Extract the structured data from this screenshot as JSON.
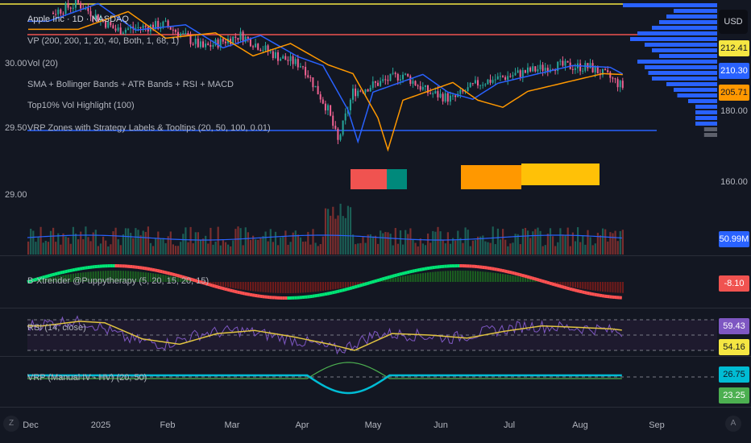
{
  "legends": {
    "symbol": "Apple Inc · 1D · NASDAQ",
    "vp": "VP (200, 200, 1, 20, 40, Both, 1, 68, 1)",
    "vol": "Vol (20)",
    "sma": "SMA + Bollinger Bands + ATR Bands + RSI + MACD",
    "top10": "Top10% Vol Highlight (100)",
    "vrpzones": "VRP Zones with Strategy Labels & Tooltips (20, 50, 100, 0.01)",
    "xtrender": "B-Xtrender @Puppytherapy (5, 20, 15, 20, 15)",
    "rsi": "RSI (14, close)",
    "vrp": "VRP (Manual IV - HV) (20, 50)"
  },
  "left_axis": [
    "30.00",
    "29.50",
    "29.00"
  ],
  "right_axis": {
    "currency": "USD",
    "price_labels": [
      {
        "text": "212.41",
        "bg": "#f5e642",
        "fg": "#131722"
      },
      {
        "text": "210.30",
        "bg": "#2962ff",
        "fg": "#ffffff"
      },
      {
        "text": "205.71",
        "bg": "#ff9800",
        "fg": "#131722"
      }
    ],
    "ticks": [
      "180.00",
      "160.00"
    ],
    "volume": {
      "text": "50.99M",
      "bg": "#2962ff"
    },
    "xtrender": {
      "text": "-8.10",
      "bg": "#f05350"
    },
    "rsi": [
      {
        "text": "59.43",
        "bg": "#7e57c2",
        "fg": "#ffffff"
      },
      {
        "text": "54.16",
        "bg": "#f5e642",
        "fg": "#131722"
      }
    ],
    "vrp": [
      {
        "text": "26.75",
        "bg": "#00bcd4",
        "fg": "#131722"
      },
      {
        "text": "23.25",
        "bg": "#4caf50",
        "fg": "#ffffff"
      }
    ]
  },
  "time_axis": [
    "Dec",
    "2025",
    "Feb",
    "Mar",
    "Apr",
    "May",
    "Jun",
    "Jul",
    "Aug",
    "Sep"
  ],
  "buttons": {
    "zoom": "Z",
    "auto": "A"
  },
  "colors": {
    "up": "#26a69a",
    "down": "#ef5350",
    "sma_blue": "#2962ff",
    "sma_orange": "#ff9800",
    "rsi": "#7e57c2",
    "rsi_ma": "#f5e642"
  },
  "series": {
    "price_keypoints": [
      [
        0,
        240
      ],
      [
        20,
        250
      ],
      [
        35,
        235
      ],
      [
        55,
        238
      ],
      [
        70,
        225
      ],
      [
        85,
        232
      ],
      [
        100,
        220
      ],
      [
        110,
        215
      ],
      [
        120,
        190
      ],
      [
        124,
        172
      ],
      [
        130,
        200
      ],
      [
        140,
        205
      ],
      [
        150,
        210
      ],
      [
        160,
        200
      ],
      [
        170,
        196
      ],
      [
        180,
        205
      ],
      [
        195,
        210
      ],
      [
        210,
        215
      ],
      [
        225,
        214
      ],
      [
        233,
        208
      ],
      [
        238,
        203
      ]
    ],
    "rsi_keypoints": [
      [
        0,
        62
      ],
      [
        15,
        68
      ],
      [
        25,
        66
      ],
      [
        40,
        45
      ],
      [
        55,
        38
      ],
      [
        70,
        52
      ],
      [
        85,
        56
      ],
      [
        100,
        48
      ],
      [
        115,
        38
      ],
      [
        125,
        30
      ],
      [
        140,
        52
      ],
      [
        155,
        50
      ],
      [
        170,
        46
      ],
      [
        185,
        55
      ],
      [
        200,
        62
      ],
      [
        215,
        60
      ],
      [
        228,
        58
      ],
      [
        238,
        54
      ]
    ]
  }
}
